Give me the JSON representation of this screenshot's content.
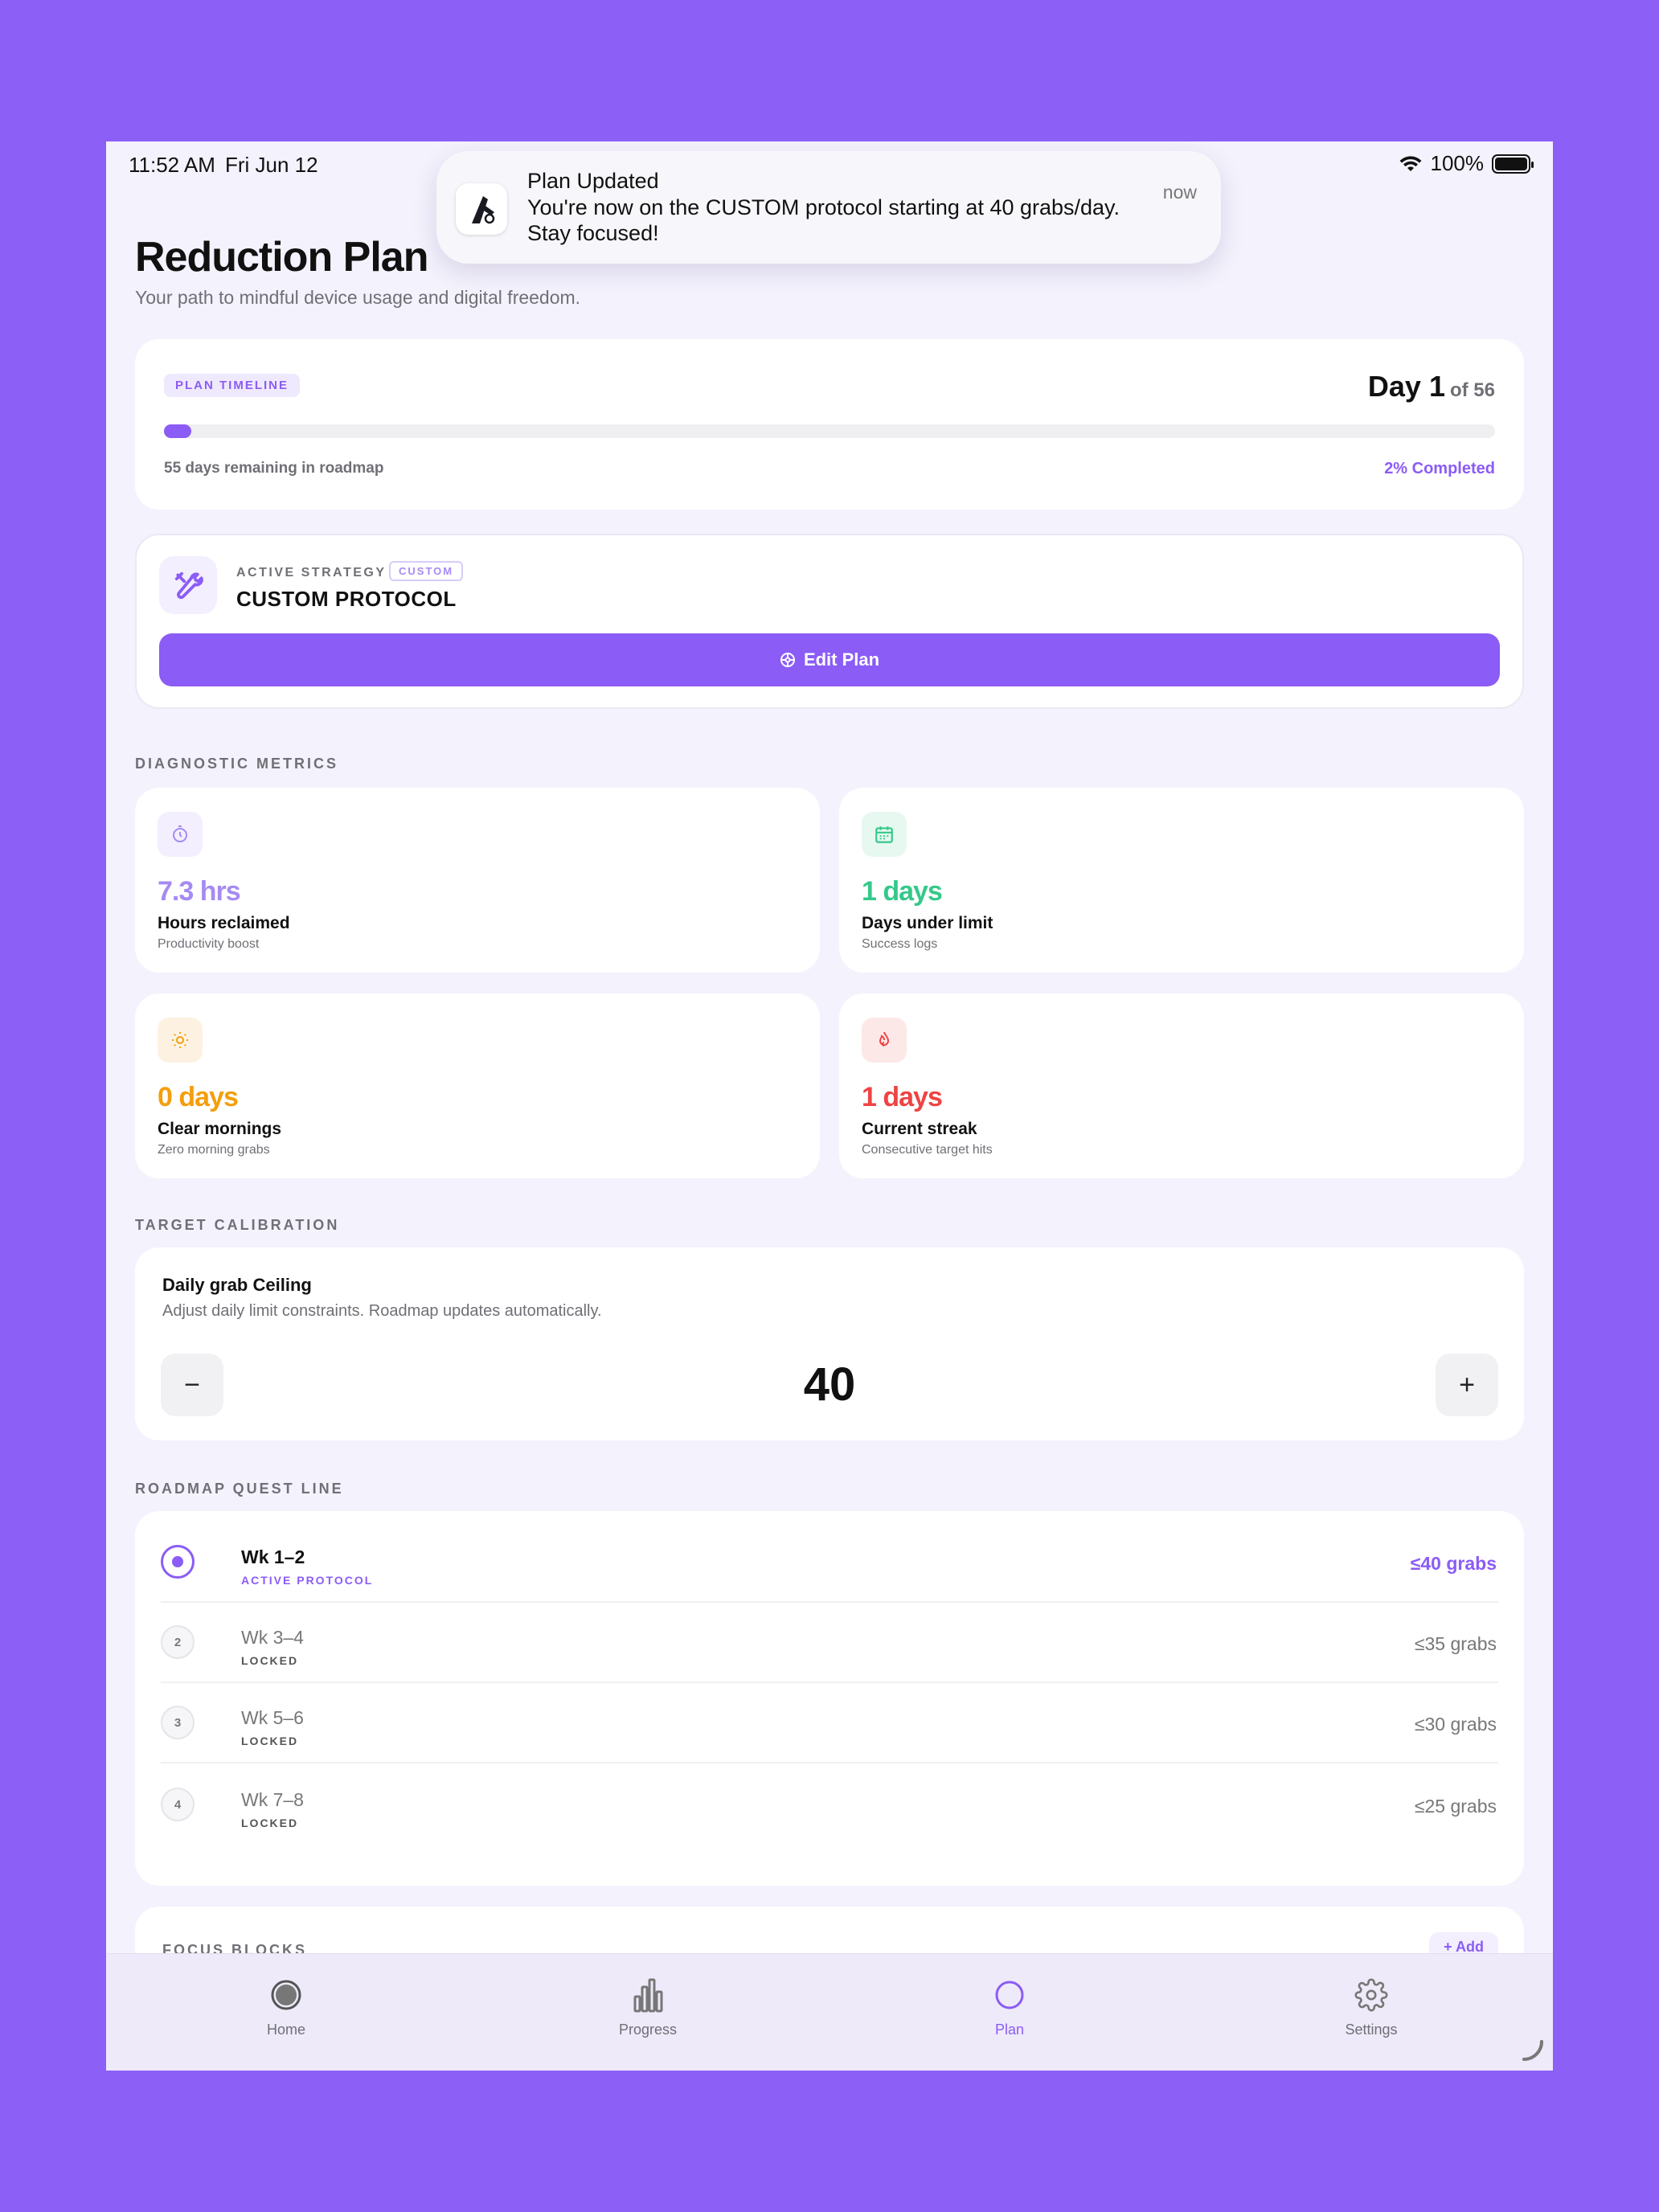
{
  "status_bar": {
    "time": "11:52 AM",
    "date": "Fri Jun 12",
    "battery": "100%"
  },
  "notification": {
    "title": "Plan Updated",
    "body": "You're now on the CUSTOM protocol starting at 40 grabs/day. Stay focused!",
    "time": "now"
  },
  "header": {
    "title": "Reduction Plan",
    "subtitle": "Your path to mindful device usage and digital freedom."
  },
  "timeline": {
    "badge": "PLAN TIMELINE",
    "day_label": "Day 1",
    "of_label": "of 56",
    "progress_fraction": 0.02,
    "remaining": "55 days remaining in roadmap",
    "completed": "2% Completed"
  },
  "strategy": {
    "label": "ACTIVE STRATEGY",
    "badge": "CUSTOM",
    "name": "CUSTOM PROTOCOL",
    "button": "Edit Plan"
  },
  "metrics": {
    "section": "DIAGNOSTIC METRICS",
    "items": [
      {
        "value": "7.3 hrs",
        "label": "Hours reclaimed",
        "sub": "Productivity boost",
        "icon": "stopwatch-icon",
        "color": "#a68af3",
        "bg": "#f3effe"
      },
      {
        "value": "1 days",
        "label": "Days under limit",
        "sub": "Success logs",
        "icon": "calendar-icon",
        "color": "#34c98a",
        "bg": "#e6f8ef"
      },
      {
        "value": "0 days",
        "label": "Clear mornings",
        "sub": "Zero morning grabs",
        "icon": "sun-icon",
        "color": "#f59e0b",
        "bg": "#fdf2e2"
      },
      {
        "value": "1 days",
        "label": "Current streak",
        "sub": "Consecutive target hits",
        "icon": "flame-icon",
        "color": "#ef4444",
        "bg": "#fde8e8"
      }
    ]
  },
  "calibration": {
    "section": "TARGET CALIBRATION",
    "title": "Daily grab Ceiling",
    "subtitle": "Adjust daily limit constraints. Roadmap updates automatically.",
    "value": "40",
    "minus": "−",
    "plus": "+"
  },
  "roadmap": {
    "section": "ROADMAP QUEST LINE",
    "items": [
      {
        "marker": "",
        "name": "Wk 1–2",
        "status": "ACTIVE PROTOCOL",
        "limit": "≤40 grabs",
        "active": true
      },
      {
        "marker": "2",
        "name": "Wk 3–4",
        "status": "LOCKED",
        "limit": "≤35 grabs",
        "active": false
      },
      {
        "marker": "3",
        "name": "Wk 5–6",
        "status": "LOCKED",
        "limit": "≤30 grabs",
        "active": false
      },
      {
        "marker": "4",
        "name": "Wk 7–8",
        "status": "LOCKED",
        "limit": "≤25 grabs",
        "active": false
      }
    ]
  },
  "focus": {
    "title": "FOCUS BLOCKS",
    "add": "Add"
  },
  "tabs": [
    {
      "label": "Home",
      "icon": "home-icon"
    },
    {
      "label": "Progress",
      "icon": "bar-chart-icon"
    },
    {
      "label": "Plan",
      "icon": "circle-icon",
      "active": true
    },
    {
      "label": "Settings",
      "icon": "gear-icon"
    }
  ],
  "colors": {
    "accent": "#8b5cf6",
    "background": "#8c5ff7"
  }
}
